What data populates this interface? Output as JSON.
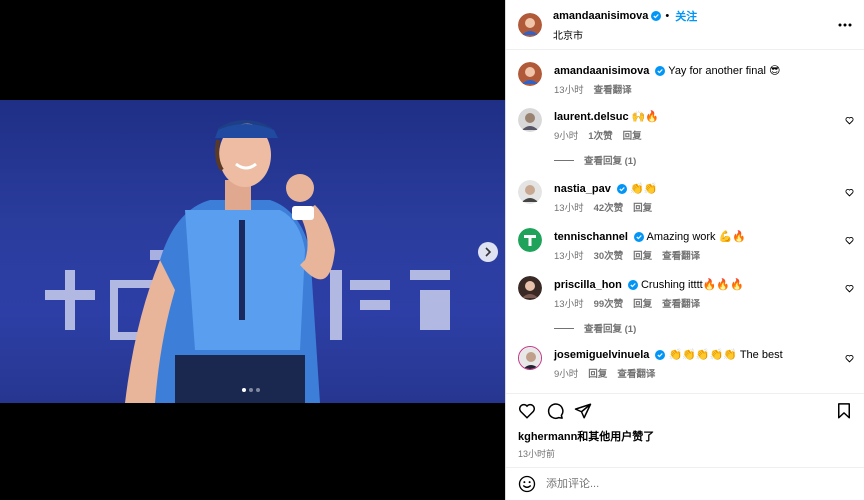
{
  "post": {
    "username": "amandaanisimova",
    "follow_label": "关注",
    "location": "北京市",
    "carousel_dots": 3,
    "active_dot": 1
  },
  "colors": {
    "accent": "#0095f6",
    "verified": "#0095f6",
    "meta": "#737373"
  },
  "caption": {
    "username": "amandaanisimova",
    "text": "Yay for another final 😎",
    "time": "13小时",
    "translate": "查看翻译"
  },
  "comments": [
    {
      "username": "laurent.delsuc",
      "verified": false,
      "text": "🙌🔥",
      "time": "9小时",
      "likes": "1次赞",
      "reply": "回复",
      "translate": "",
      "avatar_icon": "avatar-man-icon",
      "replies": "查看回复 (1)"
    },
    {
      "username": "nastia_pav",
      "verified": true,
      "text": "👏👏",
      "time": "13小时",
      "likes": "42次赞",
      "reply": "回复",
      "translate": "",
      "avatar_icon": "avatar-woman-icon",
      "replies": ""
    },
    {
      "username": "tennischannel",
      "verified": true,
      "text": "Amazing work 💪🔥",
      "time": "13小时",
      "likes": "30次赞",
      "reply": "回复",
      "translate": "查看翻译",
      "avatar_icon": "tennis-channel-logo-icon",
      "replies": ""
    },
    {
      "username": "priscilla_hon",
      "verified": true,
      "text": "Crushing itttt🔥🔥🔥",
      "time": "13小时",
      "likes": "99次赞",
      "reply": "回复",
      "translate": "查看翻译",
      "avatar_icon": "avatar-woman-icon",
      "replies": "查看回复 (1)"
    },
    {
      "username": "josemiguelvinuela",
      "verified": true,
      "text": "👏👏👏👏👏 The best",
      "time": "9小时",
      "likes": "",
      "reply": "回复",
      "translate": "查看翻译",
      "avatar_icon": "avatar-man-icon",
      "replies": ""
    }
  ],
  "actions": {
    "likes_text": "kghermann和其他用户赞了",
    "posted": "13小时前"
  },
  "add_comment": {
    "placeholder": "添加评论..."
  }
}
